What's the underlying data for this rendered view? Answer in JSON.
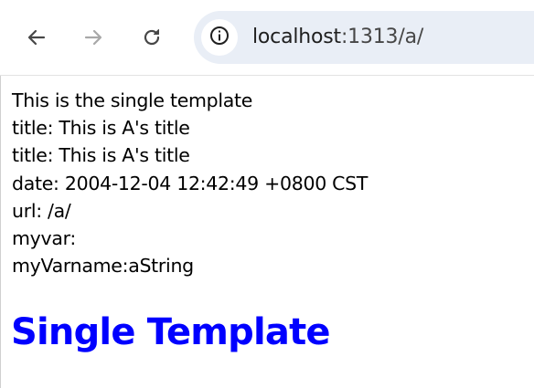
{
  "browser": {
    "back_icon": "arrow-left-icon",
    "forward_icon": "arrow-right-icon",
    "reload_icon": "reload-icon",
    "info_icon": "info-icon",
    "url": {
      "host": "localhost",
      "rest": ":1313/a/"
    }
  },
  "page": {
    "lines": [
      "This is the single template",
      "title: This is A's title",
      "title: This is A's title",
      "date: 2004-12-04 12:42:49 +0800 CST",
      "url: /a/",
      "myvar:",
      "myVarname:aString"
    ],
    "heading": "Single Template",
    "heading_color": "#0000ff"
  }
}
